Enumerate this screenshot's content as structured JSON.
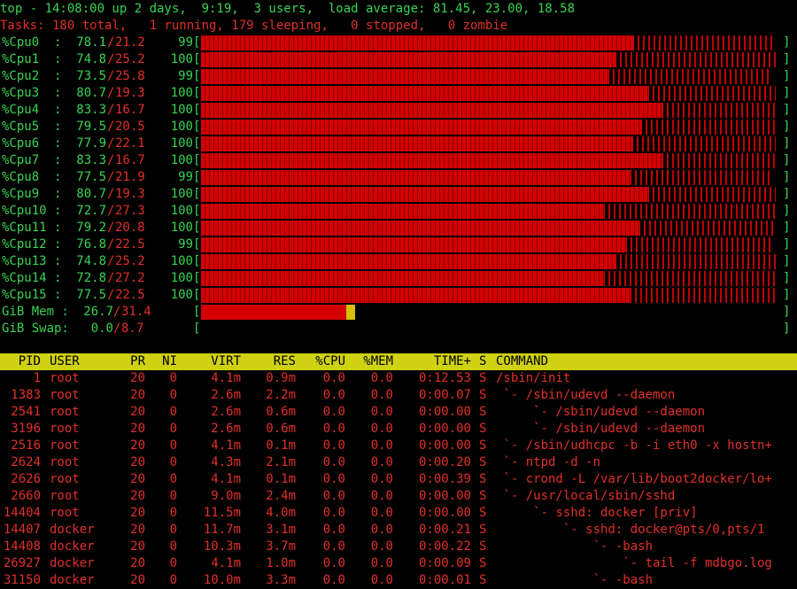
{
  "summary": {
    "line1": "top - 14:08:00 up 2 days,  9:19,  3 users,  load average: 81.45, 23.00, 18.58",
    "line2": "Tasks: 180 total,   1 running, 179 sleeping,   0 stopped,   0 zombie"
  },
  "colors": {
    "meter_user": "#d40000",
    "meter_sys": "#3a0000",
    "mem_cache": "#d6c000",
    "header_bg": "#cfd113"
  },
  "cpus": [
    {
      "label": "%Cpu0  :",
      "us": "78.1",
      "sy": "21.2",
      "tot": "99"
    },
    {
      "label": "%Cpu1  :",
      "us": "74.8",
      "sy": "25.2",
      "tot": "100"
    },
    {
      "label": "%Cpu2  :",
      "us": "73.5",
      "sy": "25.8",
      "tot": "99"
    },
    {
      "label": "%Cpu3  :",
      "us": "80.7",
      "sy": "19.3",
      "tot": "100"
    },
    {
      "label": "%Cpu4  :",
      "us": "83.3",
      "sy": "16.7",
      "tot": "100"
    },
    {
      "label": "%Cpu5  :",
      "us": "79.5",
      "sy": "20.5",
      "tot": "100"
    },
    {
      "label": "%Cpu6  :",
      "us": "77.9",
      "sy": "22.1",
      "tot": "100"
    },
    {
      "label": "%Cpu7  :",
      "us": "83.3",
      "sy": "16.7",
      "tot": "100"
    },
    {
      "label": "%Cpu8  :",
      "us": "77.5",
      "sy": "21.9",
      "tot": "99"
    },
    {
      "label": "%Cpu9  :",
      "us": "80.7",
      "sy": "19.3",
      "tot": "100"
    },
    {
      "label": "%Cpu10 :",
      "us": "72.7",
      "sy": "27.3",
      "tot": "100"
    },
    {
      "label": "%Cpu11 :",
      "us": "79.2",
      "sy": "20.8",
      "tot": "100"
    },
    {
      "label": "%Cpu12 :",
      "us": "76.8",
      "sy": "22.5",
      "tot": "99"
    },
    {
      "label": "%Cpu13 :",
      "us": "74.8",
      "sy": "25.2",
      "tot": "100"
    },
    {
      "label": "%Cpu14 :",
      "us": "72.8",
      "sy": "27.2",
      "tot": "100"
    },
    {
      "label": "%Cpu15 :",
      "us": "77.5",
      "sy": "22.5",
      "tot": "100"
    }
  ],
  "mem": {
    "label": "GiB Mem :",
    "used": "26.7",
    "total": "31.4",
    "used_frac": 0.25,
    "cache_frac": 0.015
  },
  "swap": {
    "label": "GiB Swap:",
    "used": "0.0",
    "total": "8.7",
    "used_frac": 0.0
  },
  "columns": [
    "PID",
    "USER",
    "PR",
    "NI",
    "VIRT",
    "RES",
    "%CPU",
    "%MEM",
    "TIME+",
    "S",
    "COMMAND"
  ],
  "processes": [
    {
      "pid": "1",
      "user": "root",
      "pr": "20",
      "ni": "0",
      "virt": "4.1m",
      "res": "0.9m",
      "cpu": "0.0",
      "mem": "0.0",
      "time": "0:12.53",
      "s": "S",
      "cmd": "/sbin/init"
    },
    {
      "pid": "1383",
      "user": "root",
      "pr": "20",
      "ni": "0",
      "virt": "2.6m",
      "res": "2.2m",
      "cpu": "0.0",
      "mem": "0.0",
      "time": "0:00.07",
      "s": "S",
      "cmd": " `- /sbin/udevd --daemon"
    },
    {
      "pid": "2541",
      "user": "root",
      "pr": "20",
      "ni": "0",
      "virt": "2.6m",
      "res": "0.6m",
      "cpu": "0.0",
      "mem": "0.0",
      "time": "0:00.00",
      "s": "S",
      "cmd": "     `- /sbin/udevd --daemon"
    },
    {
      "pid": "3196",
      "user": "root",
      "pr": "20",
      "ni": "0",
      "virt": "2.6m",
      "res": "0.6m",
      "cpu": "0.0",
      "mem": "0.0",
      "time": "0:00.00",
      "s": "S",
      "cmd": "     `- /sbin/udevd --daemon"
    },
    {
      "pid": "2516",
      "user": "root",
      "pr": "20",
      "ni": "0",
      "virt": "4.1m",
      "res": "0.1m",
      "cpu": "0.0",
      "mem": "0.0",
      "time": "0:00.00",
      "s": "S",
      "cmd": " `- /sbin/udhcpc -b -i eth0 -x hostn+"
    },
    {
      "pid": "2624",
      "user": "root",
      "pr": "20",
      "ni": "0",
      "virt": "4.3m",
      "res": "2.1m",
      "cpu": "0.0",
      "mem": "0.0",
      "time": "0:00.20",
      "s": "S",
      "cmd": " `- ntpd -d -n"
    },
    {
      "pid": "2626",
      "user": "root",
      "pr": "20",
      "ni": "0",
      "virt": "4.1m",
      "res": "0.1m",
      "cpu": "0.0",
      "mem": "0.0",
      "time": "0:00.39",
      "s": "S",
      "cmd": " `- crond -L /var/lib/boot2docker/lo+"
    },
    {
      "pid": "2660",
      "user": "root",
      "pr": "20",
      "ni": "0",
      "virt": "9.0m",
      "res": "2.4m",
      "cpu": "0.0",
      "mem": "0.0",
      "time": "0:00.00",
      "s": "S",
      "cmd": " `- /usr/local/sbin/sshd"
    },
    {
      "pid": "14404",
      "user": "root",
      "pr": "20",
      "ni": "0",
      "virt": "11.5m",
      "res": "4.0m",
      "cpu": "0.0",
      "mem": "0.0",
      "time": "0:00.00",
      "s": "S",
      "cmd": "     `- sshd: docker [priv]"
    },
    {
      "pid": "14407",
      "user": "docker",
      "pr": "20",
      "ni": "0",
      "virt": "11.7m",
      "res": "3.1m",
      "cpu": "0.0",
      "mem": "0.0",
      "time": "0:00.21",
      "s": "S",
      "cmd": "         `- sshd: docker@pts/0,pts/1"
    },
    {
      "pid": "14408",
      "user": "docker",
      "pr": "20",
      "ni": "0",
      "virt": "10.3m",
      "res": "3.7m",
      "cpu": "0.0",
      "mem": "0.0",
      "time": "0:00.22",
      "s": "S",
      "cmd": "             `- -bash"
    },
    {
      "pid": "26927",
      "user": "docker",
      "pr": "20",
      "ni": "0",
      "virt": "4.1m",
      "res": "1.0m",
      "cpu": "0.0",
      "mem": "0.0",
      "time": "0:00.09",
      "s": "S",
      "cmd": "                 `- tail -f mdbgo.log"
    },
    {
      "pid": "31150",
      "user": "docker",
      "pr": "20",
      "ni": "0",
      "virt": "10.0m",
      "res": "3.3m",
      "cpu": "0.0",
      "mem": "0.0",
      "time": "0:00.01",
      "s": "S",
      "cmd": "             `- -bash"
    }
  ]
}
